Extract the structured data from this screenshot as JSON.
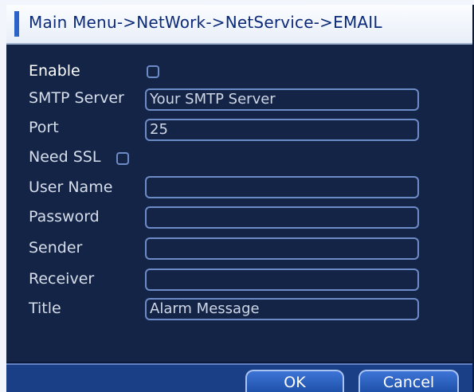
{
  "title": "Main Menu->NetWork->NetService->EMAIL",
  "form": {
    "enable_label": "Enable",
    "smtp_server_label": "SMTP Server",
    "smtp_server_value": "Your SMTP Server",
    "port_label": "Port",
    "port_value": "25",
    "need_ssl_label": "Need SSL",
    "user_name_label": "User Name",
    "password_label": "Password",
    "sender_label": "Sender",
    "receiver_label": "Receiver",
    "title_label": "Title",
    "title_value": "Alarm Message"
  },
  "buttons": {
    "ok": "OK",
    "cancel": "Cancel"
  }
}
